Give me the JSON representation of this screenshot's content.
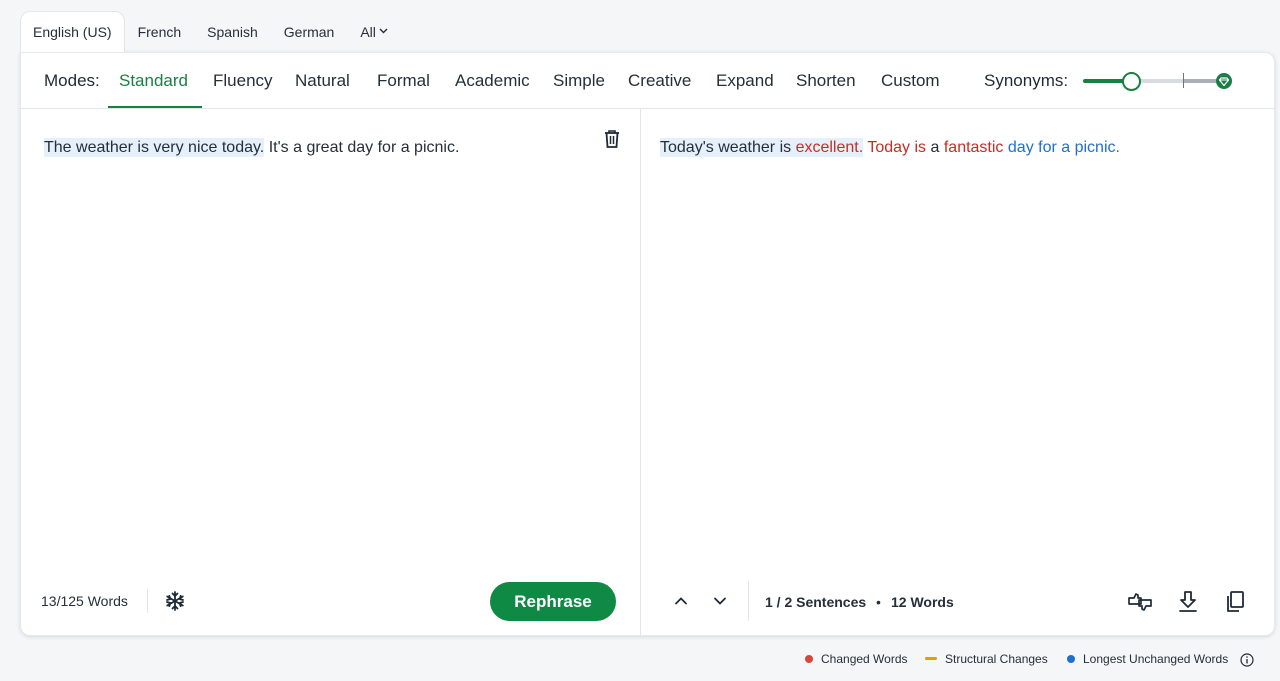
{
  "languages": {
    "tabs": [
      "English (US)",
      "French",
      "Spanish",
      "German"
    ],
    "all_label": "All",
    "active": "English (US)"
  },
  "modes": {
    "label": "Modes:",
    "items": [
      "Standard",
      "Fluency",
      "Natural",
      "Formal",
      "Academic",
      "Simple",
      "Creative",
      "Expand",
      "Shorten",
      "Custom"
    ],
    "active": "Standard"
  },
  "synonyms": {
    "label": "Synonyms:",
    "level": 0.33,
    "accent_color": "#1a7f45"
  },
  "input": {
    "sentence1": "The weather is very nice today.",
    "sentence2": "It's a great day for a picnic.",
    "word_count": "13/125 Words",
    "rephrase_label": "Rephrase"
  },
  "output": {
    "s1_unchanged": "Today's weather is",
    "s1_changed": "excellent.",
    "s2_changed_a": "Today is",
    "s2_plain": "a",
    "s2_changed_b": "fantastic",
    "s2_unchanged": "day for a picnic.",
    "sentences": "1 / 2 Sentences",
    "bullet": "•",
    "words": "12 Words"
  },
  "legend": {
    "changed": "Changed Words",
    "structural": "Structural Changes",
    "unchanged": "Longest Unchanged Words",
    "colors": {
      "changed": "#d9453a",
      "structural": "#e0a100",
      "unchanged": "#1e6fd1"
    }
  },
  "icons": [
    "chevron-down-icon",
    "trash-icon",
    "snowflake-icon",
    "chevron-up-icon",
    "compare-icon",
    "download-icon",
    "copy-icon",
    "info-icon",
    "gem-icon"
  ]
}
